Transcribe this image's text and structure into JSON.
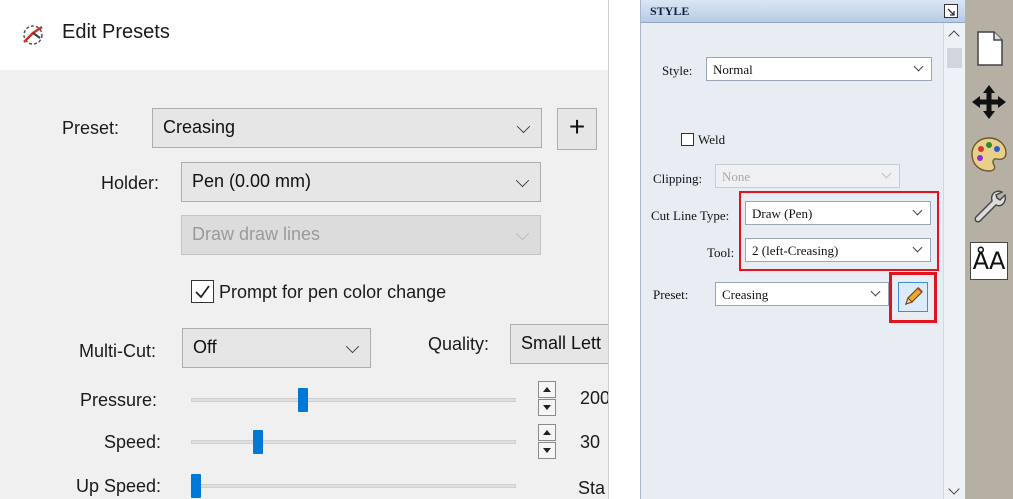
{
  "edit_presets": {
    "title": "Edit Presets",
    "preset_label": "Preset:",
    "preset_value": "Creasing",
    "add_button": "+",
    "holder_label": "Holder:",
    "holder_value": "Pen (0.00 mm)",
    "draw_value": "Draw draw lines",
    "prompt_label": "Prompt for pen color change",
    "prompt_checked": true,
    "multicut_label": "Multi-Cut:",
    "multicut_value": "Off",
    "quality_label": "Quality:",
    "quality_value": "Small Lett",
    "pressure_label": "Pressure:",
    "pressure_value": "200",
    "pressure_level": 0.33,
    "speed_label": "Speed:",
    "speed_value": "30",
    "speed_level": 0.19,
    "upspeed_label": "Up Speed:",
    "upspeed_value": "Sta",
    "upspeed_level": 0.0
  },
  "style_panel": {
    "title": "STYLE",
    "style_label": "Style:",
    "style_value": "Normal",
    "weld_label": "Weld",
    "weld_checked": false,
    "clipping_label": "Clipping:",
    "clipping_value": "None",
    "cut_line_type_label": "Cut Line Type:",
    "cut_line_type_value": "Draw (Pen)",
    "tool_label": "Tool:",
    "tool_value": "2 (left-Creasing)",
    "preset_label": "Preset:",
    "preset_value": "Creasing"
  },
  "toolbar": {
    "icons": [
      "page-icon",
      "move-icon",
      "palette-icon",
      "wrench-icon",
      "text-icon"
    ],
    "text_tool_glyph": "ÅA"
  },
  "colors": {
    "accent_blue": "#0078d7",
    "highlight_red": "#e0141e",
    "toolbar_bg": "#b5b0a3"
  }
}
